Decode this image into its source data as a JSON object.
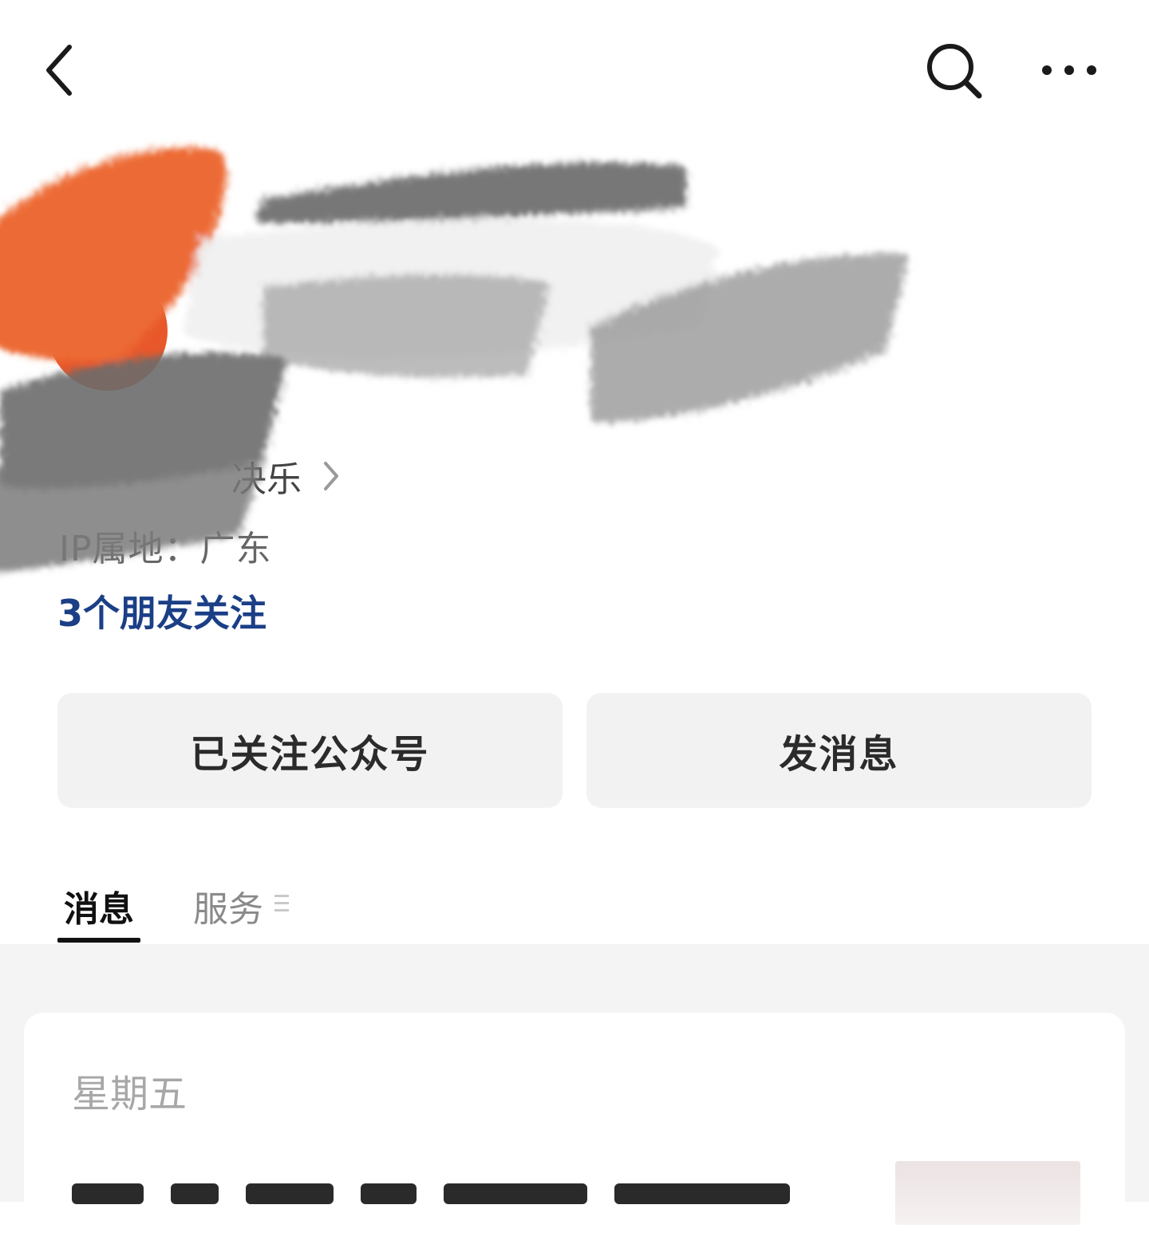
{
  "topbar": {
    "back_icon": "chevron-left-icon",
    "search_icon": "search-icon",
    "more_icon": "more-horizontal-icon"
  },
  "profile": {
    "signature_visible": "决乐",
    "ip_location": "IP属地：广东",
    "friends_following": "3个朋友关注",
    "accent_color": "#e8582a"
  },
  "actions": {
    "followed_label": "已关注公众号",
    "message_label": "发消息"
  },
  "tabs": [
    {
      "label": "消息",
      "active": true
    },
    {
      "label": "服务",
      "active": false
    }
  ],
  "feed": {
    "date_label": "星期五"
  }
}
